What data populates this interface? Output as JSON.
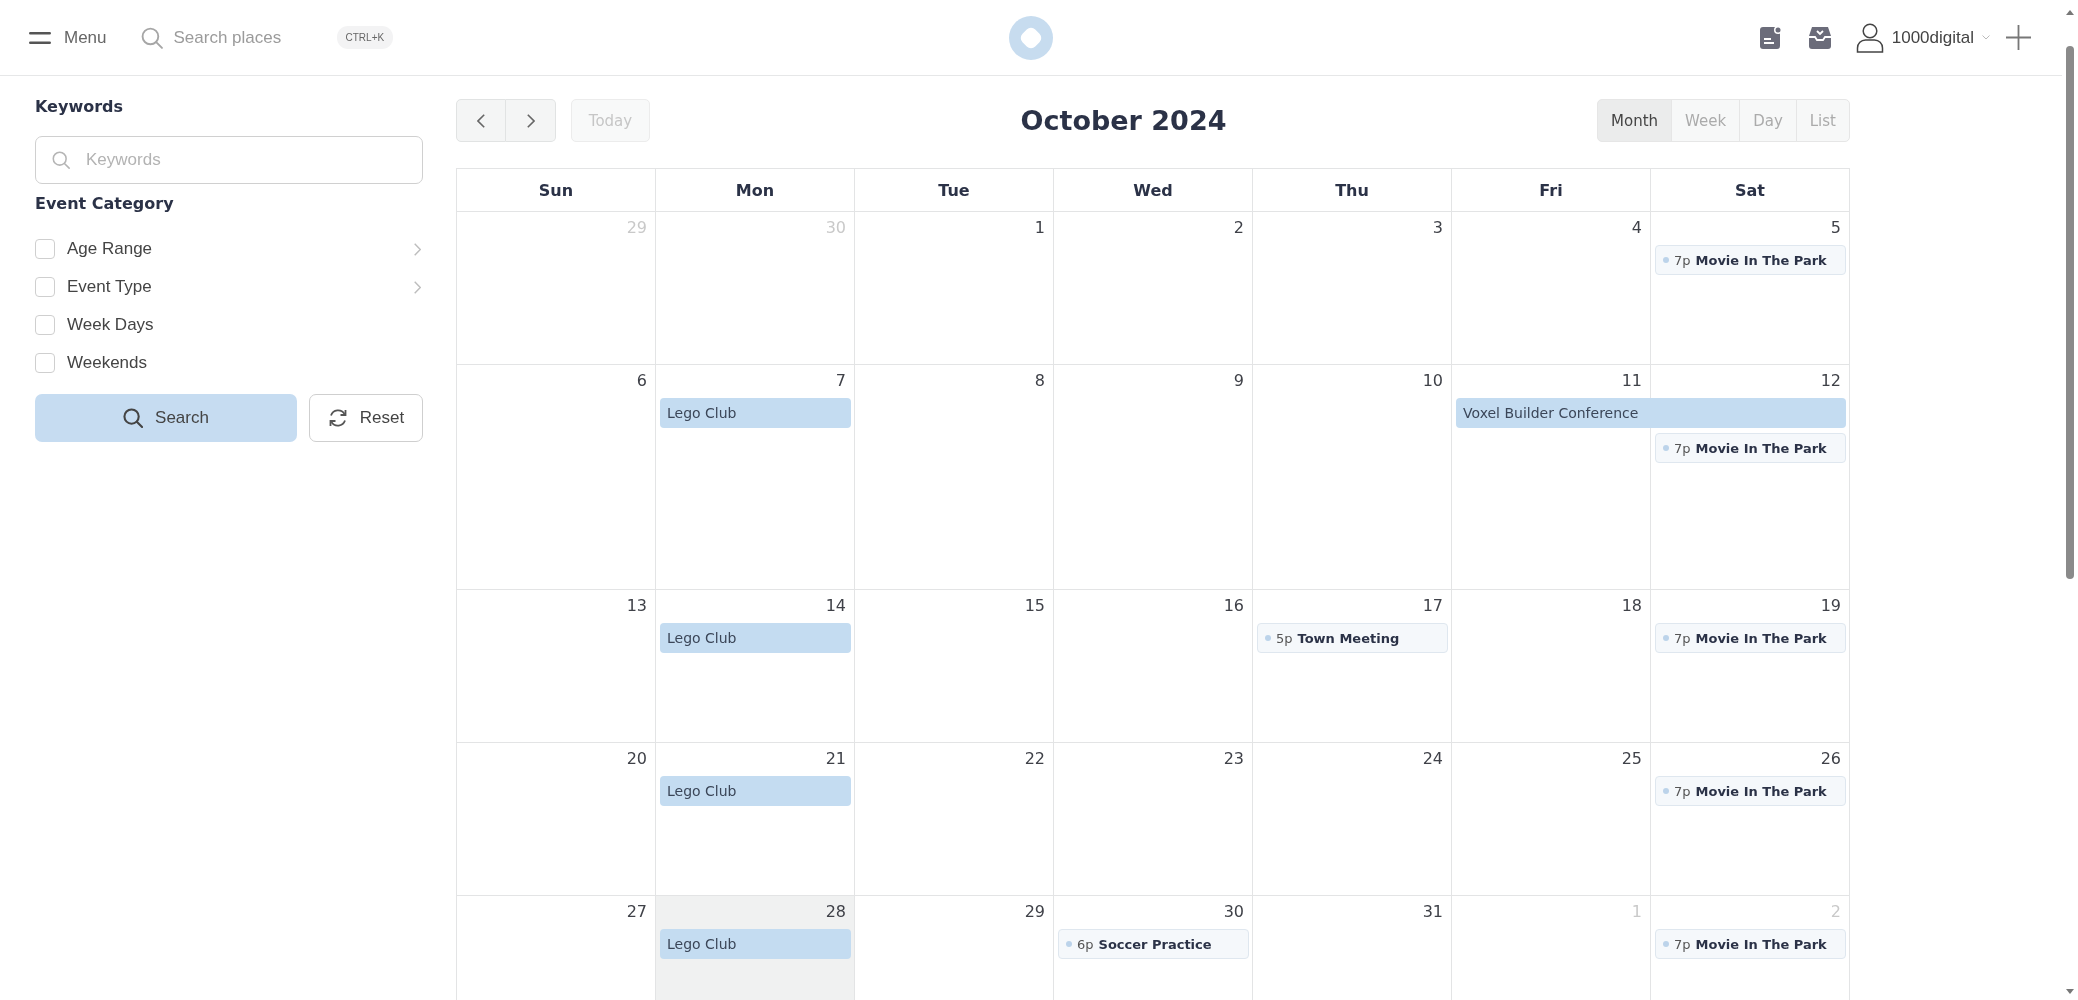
{
  "top_bar": {
    "menu_label": "Menu",
    "search": {
      "placeholder": "Search places",
      "shortcut": "CTRL+K"
    },
    "user": {
      "name": "1000digital"
    }
  },
  "filters": {
    "keywords": {
      "label": "Keywords",
      "placeholder": "Keywords"
    },
    "category": {
      "label": "Event Category",
      "options": [
        {
          "label": "Age Range",
          "checked": false,
          "expandable": true
        },
        {
          "label": "Event Type",
          "checked": false,
          "expandable": true
        },
        {
          "label": "Week Days",
          "checked": false,
          "expandable": false
        },
        {
          "label": "Weekends",
          "checked": false,
          "expandable": false
        }
      ]
    },
    "buttons": [
      {
        "kind": "search",
        "label": "Search"
      },
      {
        "kind": "reset",
        "label": "Reset"
      }
    ]
  },
  "calendar": {
    "title": "October 2024",
    "today_button": {
      "label": "Today",
      "disabled": true
    },
    "views": [
      {
        "label": "Month",
        "selected": true
      },
      {
        "label": "Week",
        "selected": false
      },
      {
        "label": "Day",
        "selected": false
      },
      {
        "label": "List",
        "selected": false
      }
    ],
    "weekdays": [
      "Sun",
      "Mon",
      "Tue",
      "Wed",
      "Thu",
      "Fri",
      "Sat"
    ],
    "weeks": [
      {
        "days": [
          {
            "date": "29",
            "other_month": true,
            "today": false
          },
          {
            "date": "30",
            "other_month": true,
            "today": false
          },
          {
            "date": "1",
            "other_month": false,
            "today": false
          },
          {
            "date": "2",
            "other_month": false,
            "today": false
          },
          {
            "date": "3",
            "other_month": false,
            "today": false
          },
          {
            "date": "4",
            "other_month": false,
            "today": false
          },
          {
            "date": "5",
            "other_month": false,
            "today": false,
            "events": [
              {
                "kind": "timed",
                "time": "7p",
                "title": "Movie In The Park"
              }
            ]
          }
        ]
      },
      {
        "days": [
          {
            "date": "6",
            "other_month": false,
            "today": false
          },
          {
            "date": "7",
            "other_month": false,
            "today": false,
            "events": [
              {
                "kind": "allday",
                "title": "Lego Club",
                "continues": false
              }
            ]
          },
          {
            "date": "8",
            "other_month": false,
            "today": false
          },
          {
            "date": "9",
            "other_month": false,
            "today": false
          },
          {
            "date": "10",
            "other_month": false,
            "today": false
          },
          {
            "date": "11",
            "other_month": false,
            "today": false,
            "events": [
              {
                "kind": "allday",
                "title": "Voxel Builder Conference",
                "continues": true
              }
            ]
          },
          {
            "date": "12",
            "other_month": false,
            "today": false,
            "events": [
              {
                "kind": "timed",
                "time": "7p",
                "title": "Movie In The Park"
              }
            ]
          }
        ]
      },
      {
        "days": [
          {
            "date": "13",
            "other_month": false,
            "today": false
          },
          {
            "date": "14",
            "other_month": false,
            "today": false,
            "events": [
              {
                "kind": "allday",
                "title": "Lego Club",
                "continues": false
              }
            ]
          },
          {
            "date": "15",
            "other_month": false,
            "today": false
          },
          {
            "date": "16",
            "other_month": false,
            "today": false
          },
          {
            "date": "17",
            "other_month": false,
            "today": false,
            "events": [
              {
                "kind": "timed",
                "time": "5p",
                "title": "Town Meeting"
              }
            ]
          },
          {
            "date": "18",
            "other_month": false,
            "today": false
          },
          {
            "date": "19",
            "other_month": false,
            "today": false,
            "events": [
              {
                "kind": "timed",
                "time": "7p",
                "title": "Movie In The Park"
              }
            ]
          }
        ]
      },
      {
        "days": [
          {
            "date": "20",
            "other_month": false,
            "today": false
          },
          {
            "date": "21",
            "other_month": false,
            "today": false,
            "events": [
              {
                "kind": "allday",
                "title": "Lego Club",
                "continues": false
              }
            ]
          },
          {
            "date": "22",
            "other_month": false,
            "today": false
          },
          {
            "date": "23",
            "other_month": false,
            "today": false
          },
          {
            "date": "24",
            "other_month": false,
            "today": false
          },
          {
            "date": "25",
            "other_month": false,
            "today": false
          },
          {
            "date": "26",
            "other_month": false,
            "today": false,
            "events": [
              {
                "kind": "timed",
                "time": "7p",
                "title": "Movie In The Park"
              }
            ]
          }
        ]
      },
      {
        "days": [
          {
            "date": "27",
            "other_month": false,
            "today": false
          },
          {
            "date": "28",
            "other_month": false,
            "today": true,
            "events": [
              {
                "kind": "allday",
                "title": "Lego Club",
                "continues": false
              }
            ]
          },
          {
            "date": "29",
            "other_month": false,
            "today": false
          },
          {
            "date": "30",
            "other_month": false,
            "today": false,
            "events": [
              {
                "kind": "timed",
                "time": "6p",
                "title": "Soccer Practice"
              }
            ]
          },
          {
            "date": "31",
            "other_month": false,
            "today": false
          },
          {
            "date": "1",
            "other_month": true,
            "today": false
          },
          {
            "date": "2",
            "other_month": true,
            "today": false,
            "events": [
              {
                "kind": "timed",
                "time": "7p",
                "title": "Movie In The Park"
              }
            ]
          }
        ]
      }
    ]
  }
}
